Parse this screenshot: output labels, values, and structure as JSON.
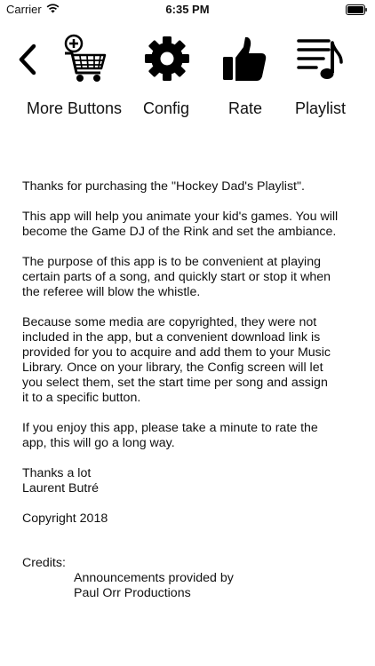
{
  "status_bar": {
    "carrier": "Carrier",
    "time": "6:35 PM"
  },
  "toolbar": {
    "back_icon": "chevron-left-icon",
    "buttons": [
      {
        "label": "More Buttons",
        "icon": "shopping-cart-plus-icon"
      },
      {
        "label": "Config",
        "icon": "gear-icon"
      },
      {
        "label": "Rate",
        "icon": "thumbs-up-icon"
      },
      {
        "label": "Playlist",
        "icon": "music-playlist-icon"
      }
    ]
  },
  "content": {
    "paragraphs": [
      [
        "Thanks for purchasing the \"Hockey Dad's Playlist\"."
      ],
      [
        "This app will help you animate your kid's games. You will",
        "become the Game DJ of the Rink and set the ambiance."
      ],
      [
        "The purpose of this app is to be convenient at playing",
        "certain parts of a song, and quickly start or stop it when",
        "the referee will blow the whistle."
      ],
      [
        "Because some media are copyrighted, they were not",
        "included in the app, but a convenient download link is",
        "provided for you to acquire and add them to your Music",
        "Library. Once on your library, the Config screen will let",
        "you select them, set the start time per song and assign",
        "it to a specific button."
      ],
      [
        "If you enjoy this app, please take a minute to rate the",
        "app, this will go a long way."
      ],
      [
        "Thanks a lot",
        "Laurent Butré"
      ],
      [
        "Copyright 2018"
      ]
    ],
    "credits_title": "Credits:",
    "credits_lines": [
      "Announcements provided by",
      "Paul Orr Productions"
    ]
  }
}
